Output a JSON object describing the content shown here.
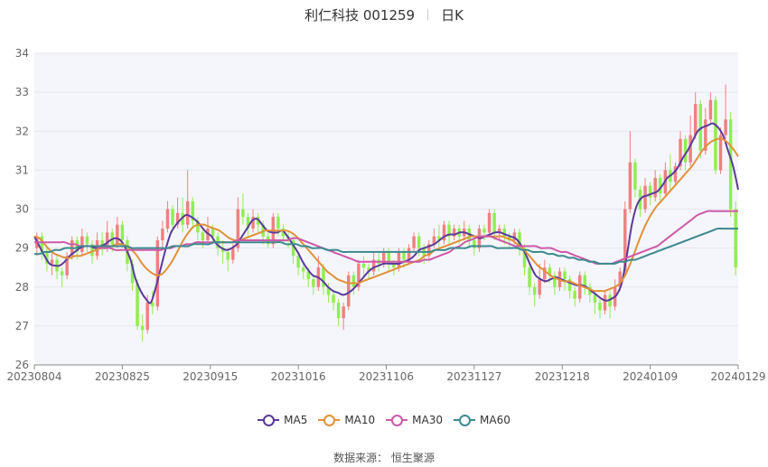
{
  "title": {
    "name": "利仁科技 001259",
    "period": "日K"
  },
  "source": "数据来源： 恒生聚源",
  "colors": {
    "up": "#f08080",
    "down": "#90ee50",
    "grid": "#e6e6ee",
    "axis": "#888888",
    "plot_bg": "#f5f6fb"
  },
  "chart_data": {
    "type": "candlestick",
    "ylim": [
      26,
      34
    ],
    "yticks": [
      "26",
      "27",
      "28",
      "29",
      "30",
      "31",
      "32",
      "33",
      "34"
    ],
    "x_tick_labels": [
      "20230804",
      "20230825",
      "20230915",
      "20231016",
      "20231106",
      "20231127",
      "20231218",
      "20240109",
      "20240129"
    ],
    "legend": [
      {
        "name": "MA5",
        "color": "#5b3a9a"
      },
      {
        "name": "MA10",
        "color": "#e0913a"
      },
      {
        "name": "MA30",
        "color": "#cc5aa8"
      },
      {
        "name": "MA60",
        "color": "#3c8a8e"
      }
    ],
    "candles": [
      [
        29.0,
        29.3,
        28.8,
        29.4
      ],
      [
        29.3,
        28.9,
        28.7,
        29.4
      ],
      [
        28.9,
        28.6,
        28.4,
        29.0
      ],
      [
        28.6,
        28.7,
        28.3,
        28.9
      ],
      [
        28.7,
        28.4,
        28.2,
        28.8
      ],
      [
        28.4,
        28.3,
        28.0,
        28.5
      ],
      [
        28.3,
        28.8,
        28.2,
        28.9
      ],
      [
        28.8,
        29.2,
        28.7,
        29.3
      ],
      [
        29.2,
        28.9,
        28.7,
        29.3
      ],
      [
        28.9,
        29.3,
        28.8,
        29.5
      ],
      [
        29.3,
        29.1,
        28.9,
        29.4
      ],
      [
        29.1,
        28.8,
        28.6,
        29.2
      ],
      [
        28.8,
        29.2,
        28.7,
        29.4
      ],
      [
        29.2,
        29.0,
        28.8,
        29.4
      ],
      [
        29.0,
        29.4,
        28.9,
        29.7
      ],
      [
        29.4,
        29.1,
        28.9,
        29.5
      ],
      [
        29.1,
        29.6,
        29.0,
        29.8
      ],
      [
        29.6,
        29.2,
        29.0,
        29.7
      ],
      [
        29.2,
        28.6,
        28.4,
        29.3
      ],
      [
        28.6,
        28.1,
        27.9,
        28.7
      ],
      [
        28.1,
        27.0,
        26.9,
        28.2
      ],
      [
        27.0,
        26.9,
        26.6,
        27.3
      ],
      [
        26.9,
        27.6,
        26.8,
        27.8
      ],
      [
        27.6,
        27.5,
        27.3,
        27.9
      ],
      [
        27.5,
        29.2,
        27.4,
        29.3
      ],
      [
        29.2,
        29.5,
        29.0,
        29.7
      ],
      [
        29.5,
        30.0,
        29.4,
        30.2
      ],
      [
        30.0,
        29.6,
        29.4,
        30.1
      ],
      [
        29.6,
        29.9,
        29.5,
        30.3
      ],
      [
        29.9,
        29.6,
        29.4,
        30.3
      ],
      [
        29.6,
        30.2,
        29.5,
        31.0
      ],
      [
        30.2,
        29.7,
        29.5,
        30.3
      ],
      [
        29.7,
        29.4,
        29.2,
        29.8
      ],
      [
        29.4,
        29.2,
        29.0,
        29.5
      ],
      [
        29.2,
        29.5,
        29.1,
        29.8
      ],
      [
        29.5,
        29.3,
        29.1,
        29.6
      ],
      [
        29.3,
        29.0,
        28.8,
        29.4
      ],
      [
        29.0,
        28.9,
        28.6,
        29.2
      ],
      [
        28.9,
        28.7,
        28.4,
        29.0
      ],
      [
        28.7,
        29.0,
        28.6,
        29.1
      ],
      [
        29.0,
        30.0,
        28.9,
        30.3
      ],
      [
        30.0,
        29.8,
        29.6,
        30.4
      ],
      [
        29.8,
        29.5,
        29.3,
        29.9
      ],
      [
        29.5,
        29.8,
        29.4,
        30.0
      ],
      [
        29.8,
        29.6,
        29.4,
        29.9
      ],
      [
        29.6,
        29.3,
        29.1,
        29.7
      ],
      [
        29.3,
        29.1,
        29.0,
        29.4
      ],
      [
        29.1,
        29.8,
        29.0,
        29.9
      ],
      [
        29.8,
        29.5,
        29.3,
        29.9
      ],
      [
        29.5,
        29.3,
        29.1,
        29.6
      ],
      [
        29.3,
        29.2,
        29.0,
        29.4
      ],
      [
        29.2,
        28.8,
        28.6,
        29.3
      ],
      [
        28.8,
        28.5,
        28.3,
        28.9
      ],
      [
        28.5,
        28.4,
        28.2,
        28.6
      ],
      [
        28.4,
        28.2,
        28.0,
        28.5
      ],
      [
        28.2,
        28.0,
        27.8,
        28.3
      ],
      [
        28.0,
        28.5,
        27.9,
        28.8
      ],
      [
        28.5,
        28.0,
        27.8,
        28.6
      ],
      [
        28.0,
        27.8,
        27.6,
        28.1
      ],
      [
        27.8,
        27.6,
        27.4,
        27.9
      ],
      [
        27.6,
        27.2,
        27.0,
        27.7
      ],
      [
        27.2,
        27.5,
        26.9,
        27.6
      ],
      [
        27.5,
        28.3,
        27.4,
        28.4
      ],
      [
        28.3,
        28.0,
        27.8,
        28.4
      ],
      [
        28.0,
        28.6,
        27.9,
        28.7
      ],
      [
        28.6,
        28.5,
        28.3,
        28.8
      ],
      [
        28.5,
        28.4,
        28.2,
        28.6
      ],
      [
        28.4,
        28.7,
        28.3,
        28.9
      ],
      [
        28.7,
        28.6,
        28.4,
        28.9
      ],
      [
        28.6,
        28.9,
        28.5,
        29.0
      ],
      [
        28.9,
        28.6,
        28.4,
        29.0
      ],
      [
        28.6,
        28.5,
        28.3,
        28.7
      ],
      [
        28.5,
        28.9,
        28.4,
        29.0
      ],
      [
        28.9,
        28.7,
        28.5,
        29.0
      ],
      [
        28.7,
        29.0,
        28.6,
        29.1
      ],
      [
        29.0,
        29.3,
        28.9,
        29.4
      ],
      [
        29.3,
        29.0,
        28.8,
        29.4
      ],
      [
        29.0,
        28.8,
        28.6,
        29.1
      ],
      [
        28.8,
        29.1,
        28.7,
        29.2
      ],
      [
        29.1,
        29.3,
        29.0,
        29.5
      ],
      [
        29.3,
        29.2,
        29.0,
        29.6
      ],
      [
        29.2,
        29.6,
        29.1,
        29.7
      ],
      [
        29.6,
        29.3,
        29.1,
        29.7
      ],
      [
        29.3,
        29.5,
        29.2,
        29.6
      ],
      [
        29.5,
        29.3,
        29.1,
        29.6
      ],
      [
        29.3,
        29.5,
        29.2,
        29.7
      ],
      [
        29.5,
        29.2,
        29.0,
        29.6
      ],
      [
        29.2,
        29.0,
        28.8,
        29.3
      ],
      [
        29.0,
        29.5,
        28.9,
        29.6
      ],
      [
        29.5,
        29.4,
        29.2,
        29.6
      ],
      [
        29.4,
        29.9,
        29.3,
        30.0
      ],
      [
        29.9,
        29.4,
        29.2,
        30.0
      ],
      [
        29.4,
        29.5,
        29.2,
        29.6
      ],
      [
        29.5,
        29.3,
        29.1,
        29.6
      ],
      [
        29.3,
        29.2,
        29.0,
        29.4
      ],
      [
        29.2,
        29.4,
        29.1,
        29.5
      ],
      [
        29.4,
        29.0,
        28.8,
        29.5
      ],
      [
        29.0,
        28.5,
        28.3,
        29.1
      ],
      [
        28.5,
        28.0,
        27.8,
        28.6
      ],
      [
        28.0,
        27.8,
        27.5,
        28.1
      ],
      [
        27.8,
        28.2,
        27.7,
        28.6
      ],
      [
        28.2,
        28.5,
        28.1,
        28.7
      ],
      [
        28.5,
        28.3,
        28.1,
        28.6
      ],
      [
        28.3,
        28.0,
        27.8,
        28.4
      ],
      [
        28.0,
        28.4,
        27.9,
        28.5
      ],
      [
        28.4,
        28.2,
        27.9,
        28.5
      ],
      [
        28.2,
        27.9,
        27.7,
        28.3
      ],
      [
        27.9,
        27.7,
        27.5,
        28.0
      ],
      [
        27.7,
        28.3,
        27.6,
        28.4
      ],
      [
        28.3,
        28.0,
        27.8,
        28.4
      ],
      [
        28.0,
        27.8,
        27.6,
        28.1
      ],
      [
        27.8,
        27.6,
        27.3,
        27.9
      ],
      [
        27.6,
        27.4,
        27.2,
        27.7
      ],
      [
        27.4,
        27.8,
        27.3,
        27.9
      ],
      [
        27.8,
        27.5,
        27.2,
        27.9
      ],
      [
        27.5,
        28.0,
        27.4,
        28.2
      ],
      [
        28.0,
        28.4,
        27.9,
        28.5
      ],
      [
        28.4,
        30.0,
        28.3,
        30.2
      ],
      [
        30.0,
        31.2,
        29.9,
        32.0
      ],
      [
        31.2,
        30.5,
        30.3,
        31.3
      ],
      [
        30.5,
        30.0,
        29.8,
        30.6
      ],
      [
        30.0,
        30.6,
        29.9,
        30.8
      ],
      [
        30.6,
        30.3,
        30.1,
        30.7
      ],
      [
        30.3,
        30.8,
        30.2,
        31.0
      ],
      [
        30.8,
        30.4,
        30.2,
        30.9
      ],
      [
        30.4,
        31.0,
        30.3,
        31.2
      ],
      [
        31.0,
        30.7,
        30.5,
        31.4
      ],
      [
        30.7,
        31.1,
        30.6,
        31.2
      ],
      [
        31.1,
        31.8,
        31.0,
        32.0
      ],
      [
        31.8,
        31.2,
        31.0,
        31.9
      ],
      [
        31.2,
        31.9,
        31.1,
        32.4
      ],
      [
        31.9,
        32.7,
        31.8,
        33.0
      ],
      [
        32.7,
        31.5,
        31.3,
        32.8
      ],
      [
        31.5,
        32.3,
        31.4,
        32.6
      ],
      [
        32.3,
        32.8,
        32.2,
        33.0
      ],
      [
        32.8,
        31.0,
        30.9,
        32.9
      ],
      [
        31.0,
        31.9,
        30.9,
        32.1
      ],
      [
        31.9,
        32.3,
        31.8,
        33.2
      ],
      [
        32.3,
        30.0,
        29.8,
        32.5
      ],
      [
        30.0,
        28.5,
        28.3,
        30.2
      ]
    ],
    "ma": {
      "MA5": [
        29.3,
        29.05,
        28.8,
        28.6,
        28.55,
        28.55,
        28.65,
        28.8,
        28.9,
        29.0,
        29.05,
        29.05,
        29.0,
        29.05,
        29.1,
        29.2,
        29.25,
        29.2,
        29.0,
        28.7,
        28.2,
        27.9,
        27.7,
        27.6,
        28.0,
        28.5,
        29.0,
        29.4,
        29.6,
        29.75,
        29.85,
        29.8,
        29.7,
        29.55,
        29.4,
        29.3,
        29.1,
        29.0,
        28.95,
        29.0,
        29.1,
        29.3,
        29.5,
        29.7,
        29.75,
        29.6,
        29.45,
        29.4,
        29.4,
        29.45,
        29.3,
        29.1,
        28.9,
        28.65,
        28.45,
        28.3,
        28.25,
        28.15,
        28.0,
        27.9,
        27.85,
        27.8,
        27.85,
        27.95,
        28.1,
        28.25,
        28.4,
        28.5,
        28.55,
        28.6,
        28.6,
        28.6,
        28.6,
        28.65,
        28.7,
        28.8,
        28.95,
        29.0,
        29.05,
        29.1,
        29.2,
        29.3,
        29.35,
        29.35,
        29.4,
        29.4,
        29.35,
        29.3,
        29.25,
        29.3,
        29.35,
        29.4,
        29.4,
        29.35,
        29.3,
        29.25,
        29.1,
        28.85,
        28.55,
        28.3,
        28.2,
        28.15,
        28.2,
        28.25,
        28.2,
        28.15,
        28.1,
        28.05,
        28.05,
        28.0,
        27.9,
        27.8,
        27.7,
        27.65,
        27.7,
        27.8,
        28.1,
        28.8,
        29.6,
        30.1,
        30.3,
        30.35,
        30.4,
        30.45,
        30.6,
        30.8,
        30.9,
        31.05,
        31.3,
        31.5,
        31.75,
        32.0,
        32.1,
        32.15,
        32.2,
        32.1,
        31.9,
        31.5,
        31.1,
        30.5
      ],
      "MA10": [
        29.3,
        29.25,
        29.1,
        28.95,
        28.85,
        28.8,
        28.75,
        28.75,
        28.8,
        28.8,
        28.85,
        28.9,
        28.95,
        29.0,
        29.0,
        29.05,
        29.1,
        29.1,
        29.05,
        28.95,
        28.8,
        28.6,
        28.45,
        28.35,
        28.3,
        28.35,
        28.5,
        28.7,
        28.95,
        29.2,
        29.4,
        29.55,
        29.6,
        29.6,
        29.55,
        29.5,
        29.45,
        29.35,
        29.25,
        29.2,
        29.2,
        29.25,
        29.3,
        29.35,
        29.4,
        29.45,
        29.45,
        29.45,
        29.45,
        29.45,
        29.4,
        29.3,
        29.15,
        29.0,
        28.85,
        28.7,
        28.55,
        28.4,
        28.3,
        28.2,
        28.15,
        28.1,
        28.1,
        28.1,
        28.15,
        28.2,
        28.25,
        28.3,
        28.35,
        28.4,
        28.45,
        28.5,
        28.55,
        28.6,
        28.65,
        28.7,
        28.8,
        28.85,
        28.95,
        29.0,
        29.05,
        29.1,
        29.15,
        29.2,
        29.25,
        29.3,
        29.3,
        29.3,
        29.3,
        29.3,
        29.3,
        29.3,
        29.25,
        29.2,
        29.1,
        29.0,
        28.85,
        28.7,
        28.55,
        28.45,
        28.35,
        28.25,
        28.2,
        28.15,
        28.15,
        28.1,
        28.05,
        28.0,
        27.95,
        27.9,
        27.9,
        27.9,
        27.95,
        28.0,
        28.1,
        28.3,
        28.6,
        28.95,
        29.3,
        29.6,
        29.85,
        30.05,
        30.2,
        30.35,
        30.5,
        30.65,
        30.8,
        30.95,
        31.1,
        31.3,
        31.5,
        31.65,
        31.75,
        31.8,
        31.8,
        31.7,
        31.55,
        31.35
      ],
      "MA30": [
        29.15,
        29.15,
        29.15,
        29.15,
        29.15,
        29.15,
        29.15,
        29.1,
        29.1,
        29.05,
        29.05,
        29.05,
        29.05,
        29.0,
        29.0,
        29.0,
        28.95,
        28.95,
        28.95,
        28.95,
        28.95,
        28.95,
        28.95,
        28.95,
        28.95,
        28.95,
        29.0,
        29.0,
        29.05,
        29.05,
        29.1,
        29.1,
        29.15,
        29.15,
        29.15,
        29.15,
        29.15,
        29.15,
        29.15,
        29.15,
        29.2,
        29.2,
        29.2,
        29.2,
        29.2,
        29.2,
        29.2,
        29.2,
        29.2,
        29.2,
        29.2,
        29.25,
        29.25,
        29.2,
        29.15,
        29.1,
        29.05,
        29.0,
        28.95,
        28.9,
        28.85,
        28.8,
        28.75,
        28.7,
        28.65,
        28.65,
        28.65,
        28.65,
        28.65,
        28.65,
        28.65,
        28.65,
        28.65,
        28.65,
        28.65,
        28.65,
        28.65,
        28.7,
        28.7,
        28.75,
        28.8,
        28.85,
        28.9,
        29.0,
        29.05,
        29.15,
        29.2,
        29.25,
        29.3,
        29.3,
        29.3,
        29.25,
        29.2,
        29.15,
        29.1,
        29.05,
        29.05,
        29.05,
        29.05,
        29.05,
        29.0,
        29.0,
        29.0,
        28.95,
        28.9,
        28.9,
        28.85,
        28.8,
        28.75,
        28.7,
        28.65,
        28.6,
        28.6,
        28.6,
        28.6,
        28.65,
        28.7,
        28.75,
        28.8,
        28.85,
        28.9,
        28.95,
        29.0,
        29.05,
        29.15,
        29.25,
        29.35,
        29.45,
        29.55,
        29.65,
        29.75,
        29.85,
        29.9,
        29.95,
        29.95,
        29.95,
        29.95,
        29.95,
        29.95,
        29.95
      ],
      "MA60": [
        28.85,
        28.85,
        28.9,
        28.9,
        28.95,
        28.95,
        29.0,
        29.0,
        29.0,
        29.05,
        29.05,
        29.05,
        29.05,
        29.05,
        29.05,
        29.05,
        29.05,
        29.05,
        29.05,
        29.0,
        29.0,
        29.0,
        29.0,
        29.0,
        29.0,
        29.0,
        29.0,
        29.05,
        29.05,
        29.05,
        29.05,
        29.1,
        29.1,
        29.1,
        29.1,
        29.15,
        29.15,
        29.15,
        29.15,
        29.15,
        29.15,
        29.15,
        29.15,
        29.15,
        29.15,
        29.15,
        29.15,
        29.15,
        29.15,
        29.1,
        29.1,
        29.1,
        29.05,
        29.05,
        29.0,
        29.0,
        29.0,
        28.95,
        28.95,
        28.95,
        28.9,
        28.9,
        28.9,
        28.9,
        28.9,
        28.9,
        28.9,
        28.9,
        28.9,
        28.9,
        28.9,
        28.9,
        28.9,
        28.9,
        28.9,
        28.9,
        28.9,
        28.9,
        28.95,
        28.95,
        28.95,
        29.0,
        29.0,
        29.0,
        29.0,
        29.05,
        29.05,
        29.05,
        29.05,
        29.05,
        29.0,
        29.0,
        29.0,
        29.0,
        29.0,
        28.95,
        28.95,
        28.9,
        28.9,
        28.9,
        28.85,
        28.85,
        28.8,
        28.8,
        28.75,
        28.75,
        28.7,
        28.7,
        28.65,
        28.65,
        28.6,
        28.6,
        28.6,
        28.6,
        28.65,
        28.65,
        28.7,
        28.7,
        28.75,
        28.8,
        28.85,
        28.9,
        28.95,
        29.0,
        29.05,
        29.1,
        29.15,
        29.2,
        29.25,
        29.3,
        29.35,
        29.4,
        29.45,
        29.5,
        29.5,
        29.5,
        29.5,
        29.5
      ]
    }
  }
}
